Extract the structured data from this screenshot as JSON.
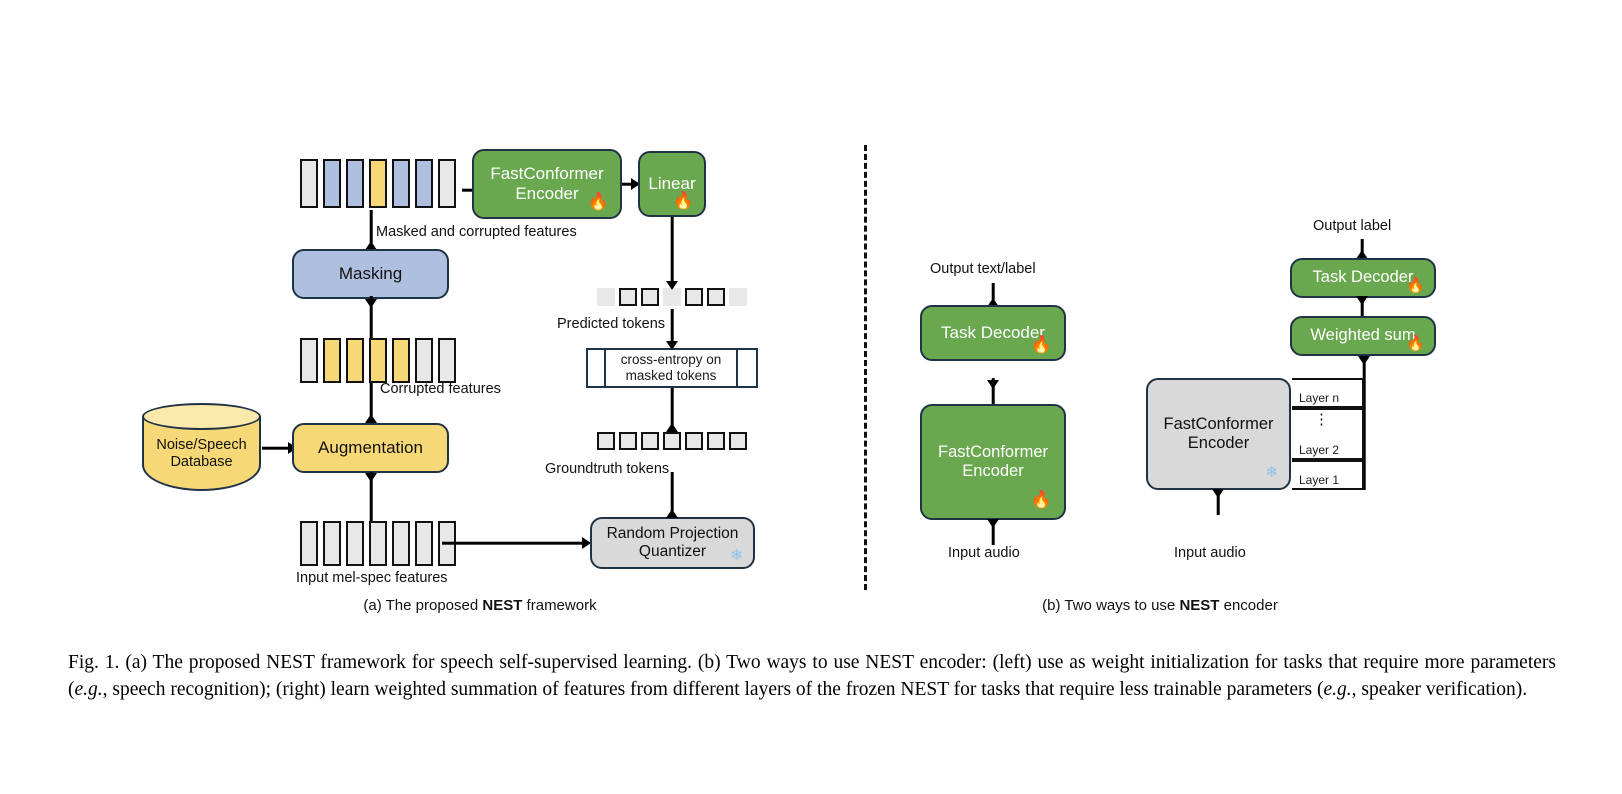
{
  "figure": {
    "panel_a": {
      "caption_prefix": "(a) The proposed ",
      "caption_bold": "NEST",
      "caption_suffix": " framework",
      "nodes": {
        "fastconformer_encoder": "FastConformer\nEncoder",
        "linear": "Linear",
        "masking": "Masking",
        "augmentation": "Augmentation",
        "noise_speech_database": "Noise/Speech\nDatabase",
        "random_projection_quantizer": "Random Projection\nQuantizer",
        "cross_entropy": "cross-entropy on\nmasked tokens"
      },
      "labels": {
        "masked_and_corrupted": "Masked and corrupted features",
        "corrupted": "Corrupted features",
        "input_mel_spec": "Input mel-spec features",
        "predicted_tokens": "Predicted tokens",
        "groundtruth_tokens": "Groundtruth tokens"
      },
      "strips": {
        "masked_features": [
          "gray",
          "blue",
          "blue",
          "yellow",
          "blue",
          "blue",
          "gray"
        ],
        "corrupted_features": [
          "gray",
          "yellow",
          "yellow",
          "yellow",
          "yellow",
          "gray",
          "gray"
        ],
        "input_features": [
          "gray",
          "gray",
          "gray",
          "gray",
          "gray",
          "gray",
          "gray"
        ],
        "predicted_tokens": [
          "faded",
          "gray",
          "gray",
          "faded",
          "gray",
          "gray",
          "faded"
        ],
        "groundtruth_tokens": [
          "gray",
          "gray",
          "gray",
          "gray",
          "gray",
          "gray",
          "gray"
        ]
      },
      "badges": {
        "encoder": "fire",
        "linear": "fire",
        "quantizer": "snow"
      }
    },
    "panel_b": {
      "caption_prefix": "(b) Two ways to use ",
      "caption_bold": "NEST",
      "caption_suffix": " encoder",
      "left": {
        "output_label": "Output text/label",
        "task_decoder": "Task Decoder",
        "encoder": "FastConformer\nEncoder",
        "input_label": "Input audio",
        "decoder_badge": "fire",
        "encoder_badge": "fire"
      },
      "right": {
        "output_label": "Output label",
        "task_decoder": "Task Decoder",
        "weighted_sum": "Weighted sum",
        "encoder": "FastConformer\nEncoder",
        "input_label": "Input audio",
        "layers": [
          "Layer n",
          "Layer 2",
          "Layer 1"
        ],
        "layer_dots": "⋮",
        "decoder_badge": "fire",
        "weighted_sum_badge": "fire",
        "encoder_badge": "snow"
      }
    },
    "caption": {
      "fig_number": "Fig. 1.",
      "part1": "(a) The proposed NEST framework for speech self-supervised learning. (b) Two ways to use NEST encoder: (left) use as weight initialization for tasks that require more parameters (",
      "eg1": "e.g.",
      "part2": ", speech recognition); (right) learn weighted summation of features from different layers of the frozen NEST for tasks that require less trainable parameters (",
      "eg2": "e.g.,",
      "part3": " speaker verification)."
    },
    "colors": {
      "green": "#6aa84f",
      "blue": "#aebfe0",
      "yellow": "#f7d877",
      "gray": "#d9d9d9",
      "outline": "#1f3346",
      "fire": "#ef7215",
      "snow": "#8fc4ea"
    },
    "icons": {
      "fire": "🔥",
      "snow": "❄"
    }
  }
}
